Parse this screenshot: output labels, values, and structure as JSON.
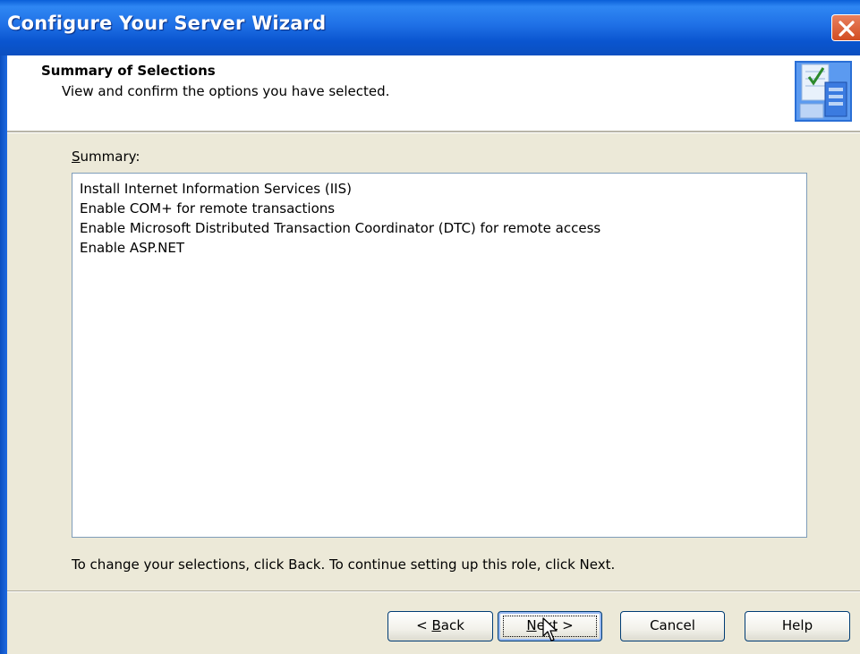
{
  "window": {
    "title": "Configure Your Server Wizard",
    "close_icon": "close-icon"
  },
  "header": {
    "title": "Summary of Selections",
    "subtitle": "View and confirm the options you have selected.",
    "icon": "server-checklist-icon"
  },
  "summary": {
    "label_underlined": "S",
    "label_rest": "ummary:",
    "items": [
      "Install Internet Information Services (IIS)",
      "Enable COM+ for remote transactions",
      "Enable Microsoft Distributed Transaction Coordinator (DTC) for remote access",
      "Enable ASP.NET"
    ]
  },
  "instruction": "To change your selections, click Back. To continue setting up this role, click Next.",
  "buttons": {
    "back_prefix": "< ",
    "back_accel": "B",
    "back_rest": "ack",
    "next_prefix": "",
    "next_accel": "N",
    "next_rest": "ext >",
    "cancel": "Cancel",
    "help": "Help"
  }
}
